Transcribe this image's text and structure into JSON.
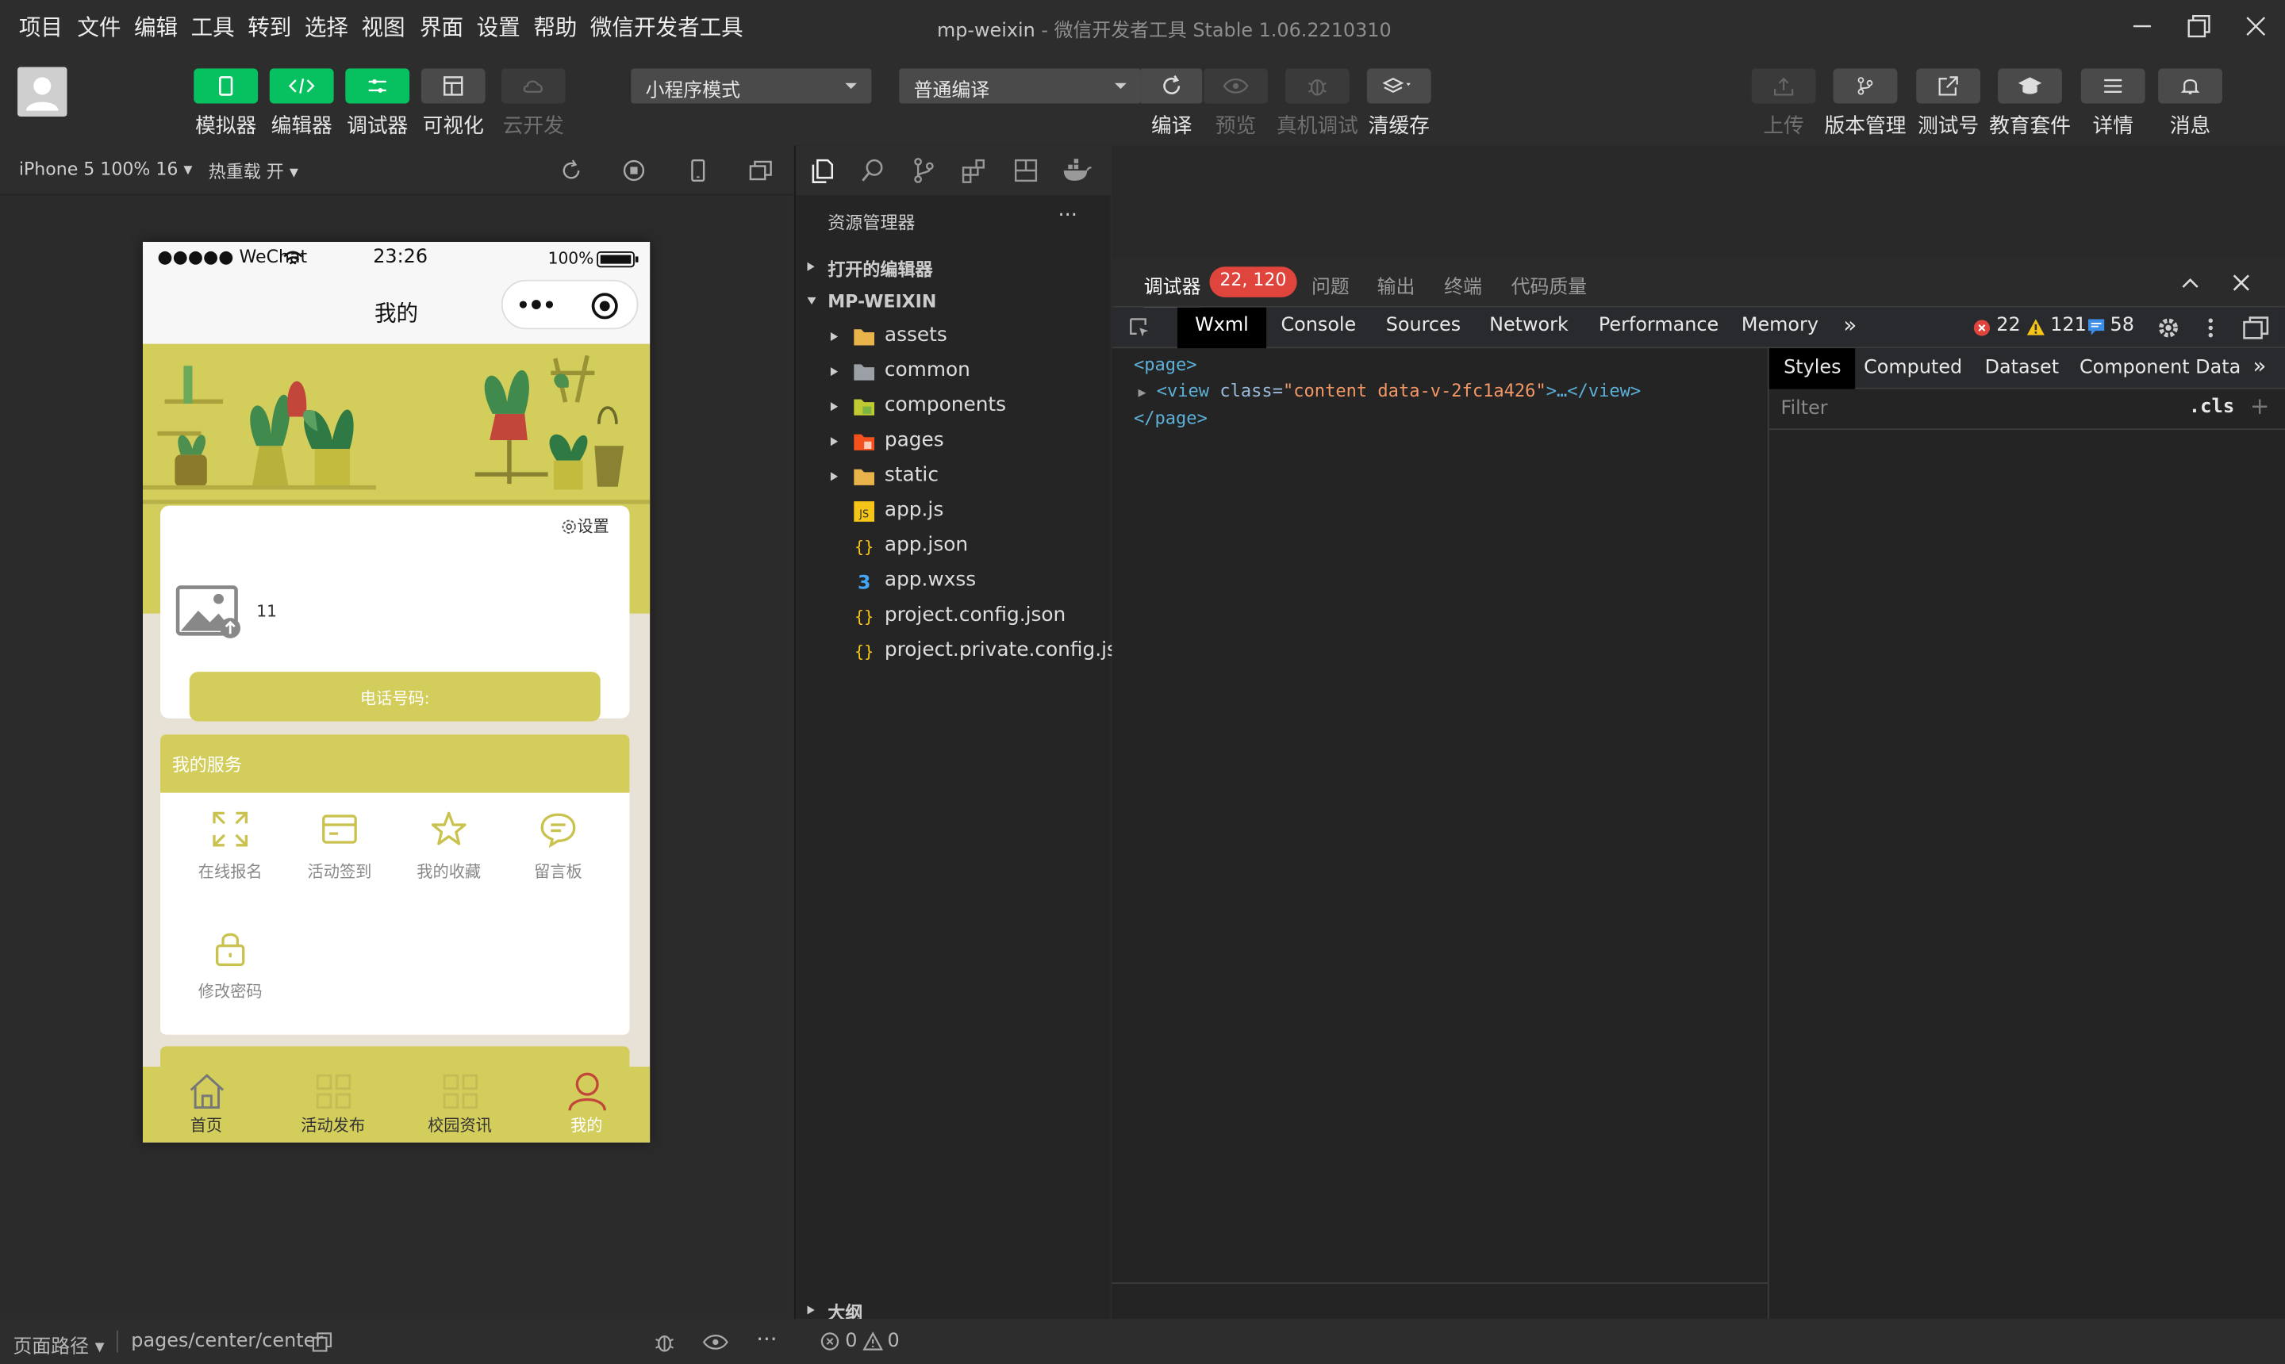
{
  "menu": [
    "项目",
    "文件",
    "编辑",
    "工具",
    "转到",
    "选择",
    "视图",
    "界面",
    "设置",
    "帮助",
    "微信开发者工具"
  ],
  "window": {
    "project": "mp-weixin",
    "separator": "-",
    "app": "微信开发者工具 Stable 1.06.2210310"
  },
  "toolbar": {
    "simulator": "模拟器",
    "editor": "编辑器",
    "debugger": "调试器",
    "visual": "可视化",
    "cloud": "云开发",
    "mode": "小程序模式",
    "compile_mode": "普通编译",
    "compile": "编译",
    "preview": "预览",
    "remote_debug": "真机调试",
    "clear_cache": "清缓存",
    "upload": "上传",
    "version": "版本管理",
    "test_account": "测试号",
    "edu": "教育套件",
    "details": "详情",
    "messages": "消息"
  },
  "simbar": {
    "device": "iPhone 5 100% 16 ▾",
    "hot_reload": "热重载 开 ▾"
  },
  "phone": {
    "status": {
      "carrier": "●●●●● WeChat",
      "time": "23:26",
      "battery": "100%"
    },
    "nav_title": "我的",
    "settings": "设置",
    "nickname": "11",
    "phone_label": "电话号码:",
    "services_title": "我的服务",
    "services": [
      {
        "label": "在线报名",
        "icon": "expand-icon"
      },
      {
        "label": "活动签到",
        "icon": "card-icon"
      },
      {
        "label": "我的收藏",
        "icon": "star-icon"
      },
      {
        "label": "留言板",
        "icon": "chat-icon"
      },
      {
        "label": "修改密码",
        "icon": "lock-icon"
      }
    ],
    "tabs": [
      {
        "label": "首页",
        "icon": "home-icon",
        "active": false
      },
      {
        "label": "活动发布",
        "icon": "grid-icon",
        "active": false
      },
      {
        "label": "校园资讯",
        "icon": "grid-icon",
        "active": false
      },
      {
        "label": "我的",
        "icon": "user-icon",
        "active": true
      }
    ],
    "accent": "#d3cd5b"
  },
  "explorer": {
    "title": "资源管理器",
    "open_editors": "打开的编辑器",
    "root": "MP-WEIXIN",
    "items": [
      {
        "name": "assets",
        "type": "folder"
      },
      {
        "name": "common",
        "type": "folder"
      },
      {
        "name": "components",
        "type": "folder"
      },
      {
        "name": "pages",
        "type": "folder"
      },
      {
        "name": "static",
        "type": "folder"
      },
      {
        "name": "app.js",
        "type": "js"
      },
      {
        "name": "app.json",
        "type": "json"
      },
      {
        "name": "app.wxss",
        "type": "css"
      },
      {
        "name": "project.config.json",
        "type": "json"
      },
      {
        "name": "project.private.config.js...",
        "type": "json"
      }
    ],
    "outline": "大纲"
  },
  "devtools": {
    "tabs": [
      "调试器",
      "问题",
      "输出",
      "终端",
      "代码质量"
    ],
    "badge": "22, 120",
    "panel_tabs": [
      "Wxml",
      "Console",
      "Sources",
      "Network",
      "Performance",
      "Memory"
    ],
    "errors": "22",
    "warnings": "121",
    "infos": "58",
    "code": {
      "line1": "<page>",
      "line2_tag_open": "<view ",
      "line2_attr": "class=",
      "line2_value": "\"content data-v-2fc1a426\"",
      "line2_rest": ">…</view>",
      "line3": "</page>"
    },
    "style_tabs": [
      "Styles",
      "Computed",
      "Dataset",
      "Component Data"
    ],
    "filter_placeholder": "Filter",
    "cls": ".cls"
  },
  "footer": {
    "page_path_label": "页面路径 ▾",
    "page_path": "pages/center/center",
    "errors": "0",
    "warnings": "0"
  }
}
